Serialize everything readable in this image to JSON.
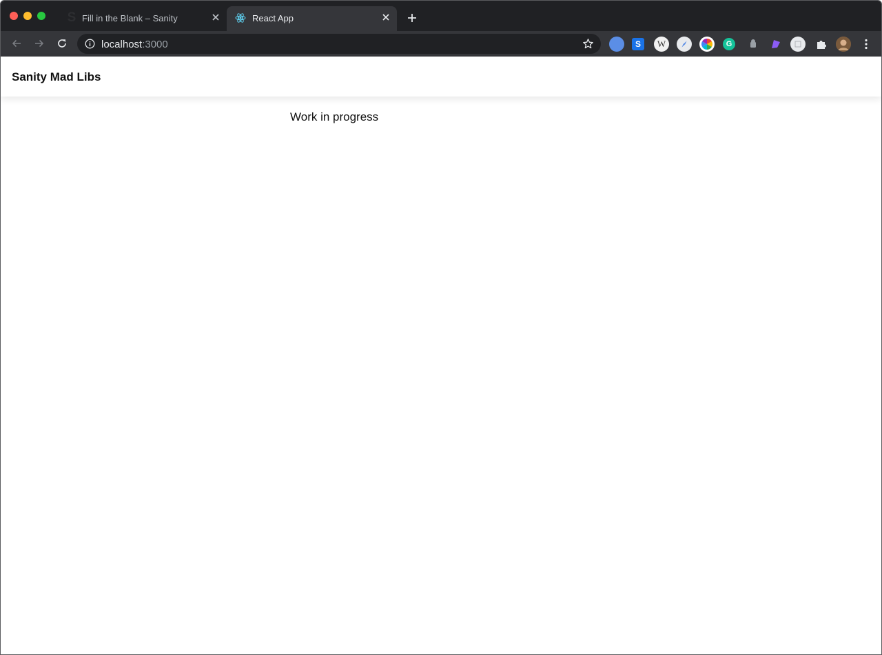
{
  "browser": {
    "tabs": [
      {
        "title": "Fill in the Blank – Sanity",
        "favicon": "sanity-s-icon",
        "active": false
      },
      {
        "title": "React App",
        "favicon": "react-icon",
        "active": true
      }
    ],
    "favicon_glyph_inactive": "S",
    "omnibox": {
      "host": "localhost",
      "port": ":3000"
    },
    "extensions": {
      "ext_2_glyph": "S",
      "ext_3_glyph": "W",
      "ext_6_glyph": "G"
    }
  },
  "app": {
    "title": "Sanity Mad Libs",
    "status": "Work in progress"
  },
  "colors": {
    "tabstrip_bg": "#202124",
    "toolbar_bg": "#35363a",
    "omnibox_bg": "#202124",
    "react_blue": "#61dafb",
    "page_bg": "#ffffff"
  }
}
